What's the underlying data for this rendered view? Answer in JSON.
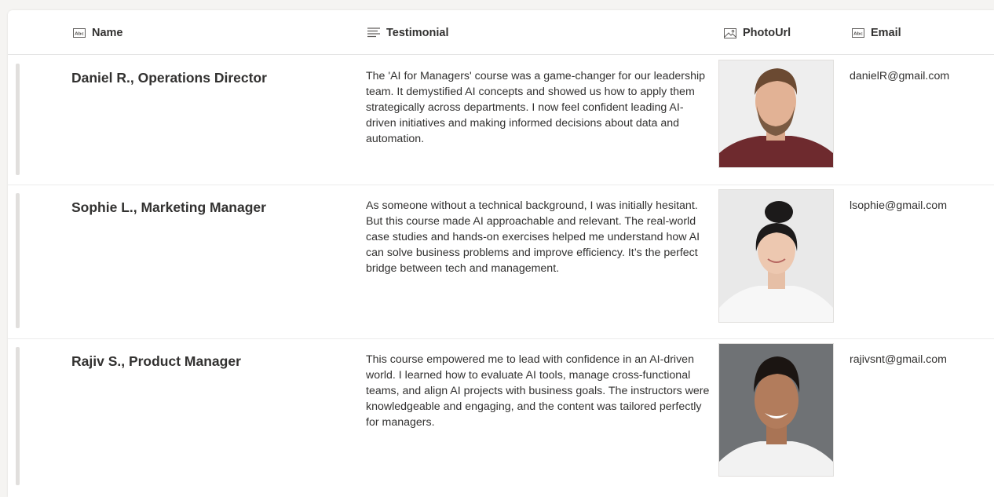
{
  "columns": {
    "name": "Name",
    "testimonial": "Testimonial",
    "photo": "PhotoUrl",
    "email": "Email"
  },
  "column_icons": {
    "name": "text-field-icon",
    "testimonial": "multiline-text-icon",
    "photo": "image-icon",
    "email": "text-field-icon"
  },
  "rows": [
    {
      "name": "Daniel R., Operations Director",
      "testimonial": "The 'AI for Managers' course was a game-changer for our leadership team. It demystified AI concepts and showed us how to apply them strategically across departments. I now feel confident leading AI-driven initiatives and making informed decisions about data and automation.",
      "email": "danielR@gmail.com"
    },
    {
      "name": "Sophie L., Marketing Manager",
      "testimonial": "As someone without a technical background, I was initially hesitant. But this course made AI approachable and relevant. The real-world case studies and hands-on exercises helped me understand how AI can solve business problems and improve efficiency. It’s the perfect bridge between tech and management.",
      "email": "lsophie@gmail.com"
    },
    {
      "name": "Rajiv S., Product Manager",
      "testimonial": "This course empowered me to lead with confidence in an AI-driven world. I learned how to evaluate AI tools, manage cross-functional teams, and align AI projects with business goals. The instructors were knowledgeable and engaging, and the content was tailored perfectly for managers.",
      "email": "rajivsnt@gmail.com"
    }
  ]
}
